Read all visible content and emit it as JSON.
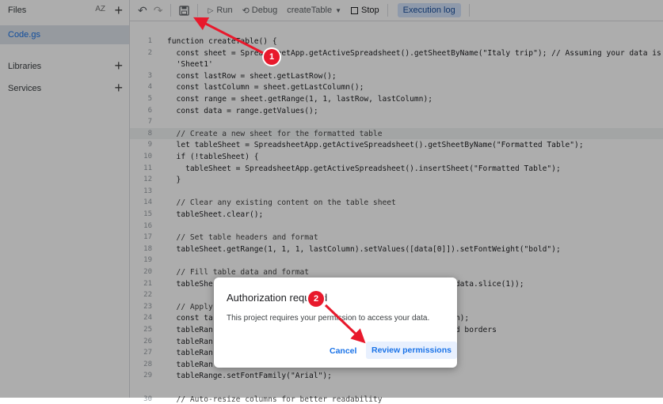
{
  "sidebar": {
    "files_label": "Files",
    "sort_label": "AZ",
    "file_name": "Code.gs",
    "libraries_label": "Libraries",
    "services_label": "Services"
  },
  "toolbar": {
    "run_label": "Run",
    "debug_label": "Debug",
    "function_name": "createTable",
    "stop_label": "Stop",
    "exec_log_label": "Execution log"
  },
  "editor": {
    "lines": [
      {
        "n": "1",
        "t": "function createTable() {"
      },
      {
        "n": "2",
        "t": "  const sheet = SpreadsheetApp.getActiveSpreadsheet().getSheetByName(\"Italy trip\"); // Assuming your data is"
      },
      {
        "n": "",
        "t": "  'Sheet1'"
      },
      {
        "n": "3",
        "t": "  const lastRow = sheet.getLastRow();"
      },
      {
        "n": "4",
        "t": "  const lastColumn = sheet.getLastColumn();"
      },
      {
        "n": "5",
        "t": "  const range = sheet.getRange(1, 1, lastRow, lastColumn);"
      },
      {
        "n": "6",
        "t": "  const data = range.getValues();"
      },
      {
        "n": "7",
        "t": ""
      },
      {
        "n": "8",
        "t": "  // Create a new sheet for the formatted table"
      },
      {
        "n": "9",
        "t": "  let tableSheet = SpreadsheetApp.getActiveSpreadsheet().getSheetByName(\"Formatted Table\");"
      },
      {
        "n": "10",
        "t": "  if (!tableSheet) {"
      },
      {
        "n": "11",
        "t": "    tableSheet = SpreadsheetApp.getActiveSpreadsheet().insertSheet(\"Formatted Table\");"
      },
      {
        "n": "12",
        "t": "  }"
      },
      {
        "n": "13",
        "t": ""
      },
      {
        "n": "14",
        "t": "  // Clear any existing content on the table sheet"
      },
      {
        "n": "15",
        "t": "  tableSheet.clear();"
      },
      {
        "n": "16",
        "t": ""
      },
      {
        "n": "17",
        "t": "  // Set table headers and format"
      },
      {
        "n": "18",
        "t": "  tableSheet.getRange(1, 1, 1, lastColumn).setValues([data[0]]).setFontWeight(\"bold\");"
      },
      {
        "n": "19",
        "t": ""
      },
      {
        "n": "20",
        "t": "  // Fill table data and format"
      },
      {
        "n": "21",
        "t": "  tableShe                                                     data.slice(1));"
      },
      {
        "n": "22",
        "t": ""
      },
      {
        "n": "23",
        "t": "  // Apply"
      },
      {
        "n": "24",
        "t": "  const ta                                                    mn);"
      },
      {
        "n": "25",
        "t": "  tableRan                                                   add borders"
      },
      {
        "n": "26",
        "t": "  tableRan"
      },
      {
        "n": "27",
        "t": "  tableRan"
      },
      {
        "n": "28",
        "t": "  tableRan"
      },
      {
        "n": "29",
        "t": "  tableRange.setFontFamily(\"Arial\");"
      },
      {
        "n": "",
        "t": ""
      },
      {
        "n": "30",
        "t": "  // Auto-resize columns for better readability"
      }
    ]
  },
  "dialog": {
    "title": "Authorization required",
    "message": "This project requires your permission to access your data.",
    "cancel_label": "Cancel",
    "review_label": "Review permissions"
  },
  "annotations": {
    "badge1": "1",
    "badge2": "2",
    "color": "#e8192c"
  }
}
